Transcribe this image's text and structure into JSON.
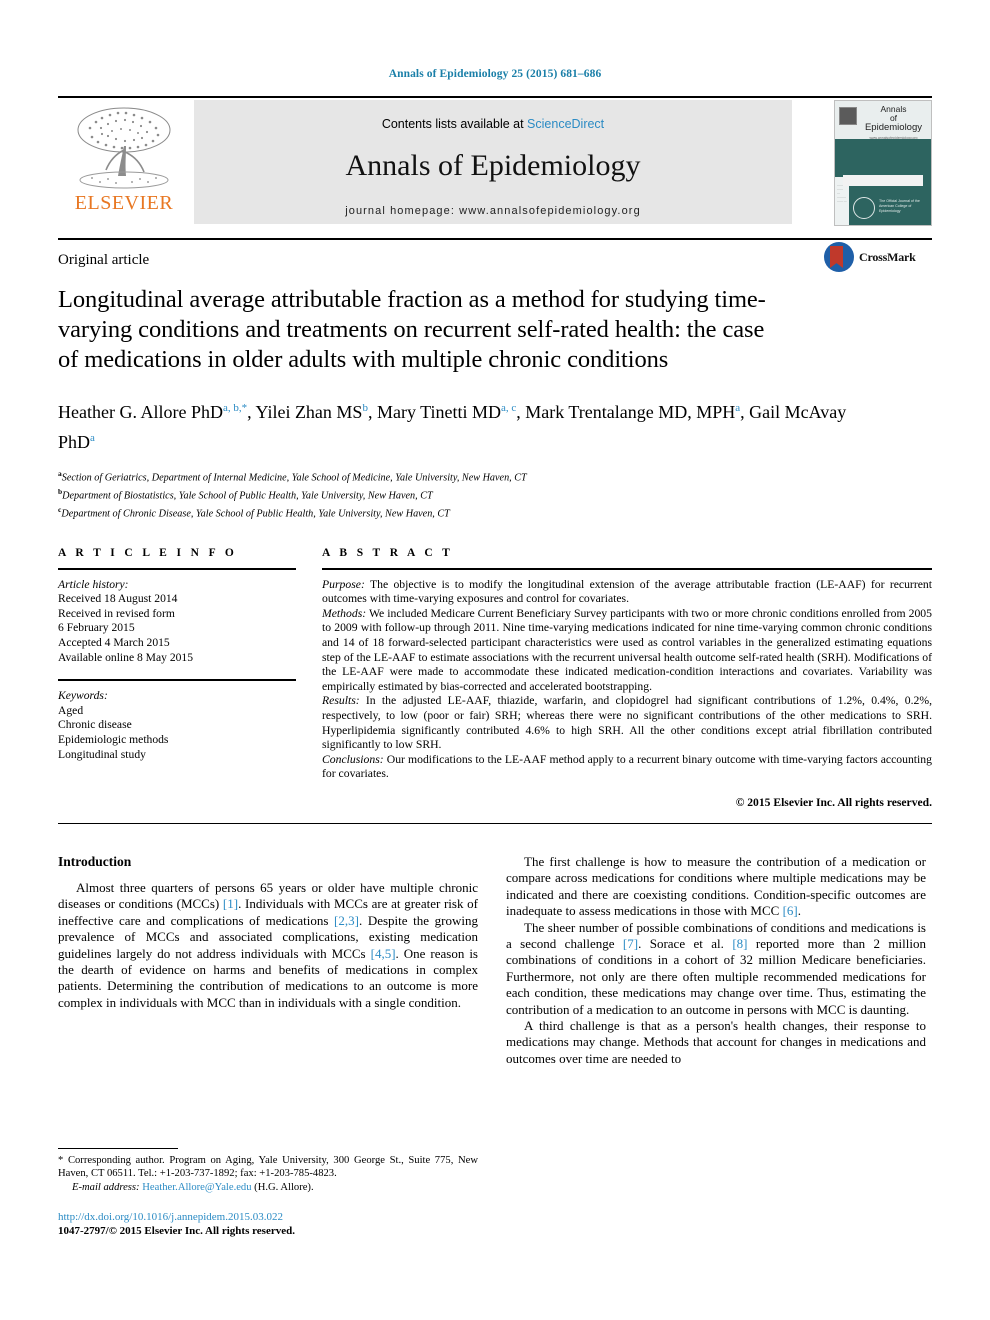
{
  "running_head": "Annals of Epidemiology 25 (2015) 681–686",
  "masthead": {
    "contents_prefix": "Contents lists available at ",
    "sciencedirect": "ScienceDirect",
    "journal_name": "Annals of Epidemiology",
    "homepage": "journal homepage: www.annalsofepidemiology.org",
    "publisher_word": "ELSEVIER",
    "publisher_logo_icon": "elsevier-tree-icon",
    "cover": {
      "line1": "Annals",
      "line2": "of",
      "line3": "Epidemiology",
      "url": "www.annalsofepidemiology.org",
      "seal_text": "The Official Journal of the American College of Epidemiology",
      "accent_color": "#2d6460"
    }
  },
  "article": {
    "type": "Original article",
    "title": "Longitudinal average attributable fraction as a method for studying time-varying conditions and treatments on recurrent self-rated health: the case of medications in older adults with multiple chronic conditions",
    "authors_html": "Heather G. Allore PhD<sup>a, b,</sup><sup>*</sup>, Yilei Zhan MS<sup>b</sup>, Mary Tinetti MD<sup>a, c</sup>, Mark Trentalange MD, MPH<sup>a</sup>, Gail McAvay PhD<sup>a</sup>",
    "affiliations": [
      {
        "mark": "a",
        "text": "Section of Geriatrics, Department of Internal Medicine, Yale School of Medicine, Yale University, New Haven, CT"
      },
      {
        "mark": "b",
        "text": "Department of Biostatistics, Yale School of Public Health, Yale University, New Haven, CT"
      },
      {
        "mark": "c",
        "text": "Department of Chronic Disease, Yale School of Public Health, Yale University, New Haven, CT"
      }
    ],
    "crossmark_label": "CrossMark"
  },
  "article_info": {
    "heading": "A R T I C L E   I N F O",
    "history_label": "Article history:",
    "history": [
      "Received 18 August 2014",
      "Received in revised form",
      "6 February 2015",
      "Accepted 4 March 2015",
      "Available online 8 May 2015"
    ],
    "keywords_label": "Keywords:",
    "keywords": [
      "Aged",
      "Chronic disease",
      "Epidemiologic methods",
      "Longitudinal study"
    ]
  },
  "abstract": {
    "heading": "A B S T R A C T",
    "sections": [
      {
        "lead": "Purpose:",
        "text": " The objective is to modify the longitudinal extension of the average attributable fraction (LE-AAF) for recurrent outcomes with time-varying exposures and control for covariates."
      },
      {
        "lead": "Methods:",
        "text": " We included Medicare Current Beneficiary Survey participants with two or more chronic conditions enrolled from 2005 to 2009 with follow-up through 2011. Nine time-varying medications indicated for nine time-varying common chronic conditions and 14 of 18 forward-selected participant characteristics were used as control variables in the generalized estimating equations step of the LE-AAF to estimate associations with the recurrent universal health outcome self-rated health (SRH). Modifications of the LE-AAF were made to accommodate these indicated medication-condition interactions and covariates. Variability was empirically estimated by bias-corrected and accelerated bootstrapping."
      },
      {
        "lead": "Results:",
        "text": " In the adjusted LE-AAF, thiazide, warfarin, and clopidogrel had significant contributions of 1.2%, 0.4%, 0.2%, respectively, to low (poor or fair) SRH; whereas there were no significant contributions of the other medications to SRH. Hyperlipidemia significantly contributed 4.6% to high SRH. All the other conditions except atrial fibrillation contributed significantly to low SRH."
      },
      {
        "lead": "Conclusions:",
        "text": " Our modifications to the LE-AAF method apply to a recurrent binary outcome with time-varying factors accounting for covariates."
      }
    ],
    "copyright": "© 2015 Elsevier Inc. All rights reserved."
  },
  "body": {
    "left_heading": "Introduction",
    "left_paragraphs": [
      "Almost three quarters of persons 65 years or older have multiple chronic diseases or conditions (MCCs) [1]. Individuals with MCCs are at greater risk of ineffective care and complications of medications [2,3]. Despite the growing prevalence of MCCs and associated complications, existing medication guidelines largely do not address individuals with MCCs [4,5]. One reason is the dearth of evidence on harms and benefits of medications in complex patients. Determining the contribution of medications to an outcome is more complex in individuals with MCC than in individuals with a single condition."
    ],
    "right_paragraphs": [
      "The first challenge is how to measure the contribution of a medication or compare across medications for conditions where multiple medications may be indicated and there are coexisting conditions. Condition-specific outcomes are inadequate to assess medications in those with MCC [6].",
      "The sheer number of possible combinations of conditions and medications is a second challenge [7]. Sorace et al. [8] reported more than 2 million combinations of conditions in a cohort of 32 million Medicare beneficiaries. Furthermore, not only are there often multiple recommended medications for each condition, these medications may change over time. Thus, estimating the contribution of a medication to an outcome in persons with MCC is daunting.",
      "A third challenge is that as a person's health changes, their response to medications may change. Methods that account for changes in medications and outcomes over time are needed to"
    ]
  },
  "footnotes": {
    "corresponding": "* Corresponding author. Program on Aging, Yale University, 300 George St., Suite 775, New Haven, CT 06511. Tel.: +1-203-737-1892; fax: +1-203-785-4823.",
    "email_label": "E-mail address:",
    "email": "Heather.Allore@Yale.edu",
    "email_suffix": " (H.G. Allore).",
    "doi": "http://dx.doi.org/10.1016/j.annepidem.2015.03.022",
    "issn": "1047-2797/© 2015 Elsevier Inc. All rights reserved."
  },
  "colors": {
    "link": "#2b8bc4",
    "running_head": "#1a7fa8",
    "elsevier_orange": "#E87722",
    "cover_teal": "#2d6460"
  }
}
